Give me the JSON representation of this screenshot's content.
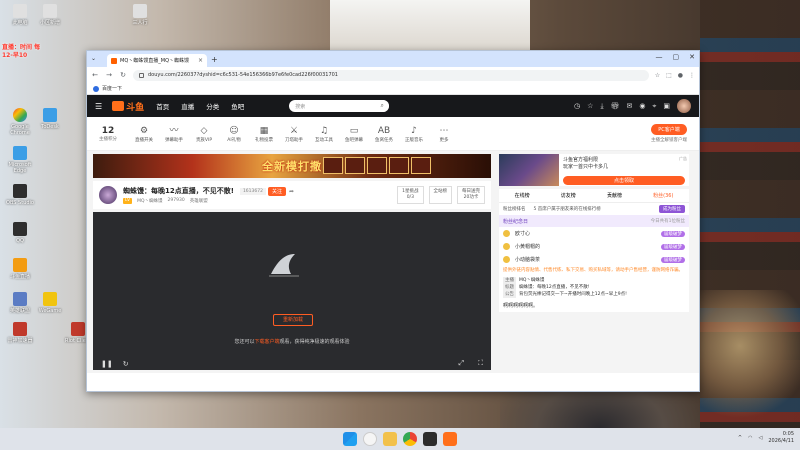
{
  "desktop": {
    "icons": [
      {
        "label": "此电脑",
        "color": "c1"
      },
      {
        "label": "小区新增",
        "color": "c1"
      },
      {
        "label": "三人行",
        "color": "c1"
      },
      {
        "label": "Google Chrome",
        "color": "c2"
      },
      {
        "label": "ToDesk",
        "color": "c3"
      },
      {
        "label": "Microsoft Edge",
        "color": "c3"
      },
      {
        "label": "OBS Studio",
        "color": "c4"
      },
      {
        "label": "QQ",
        "color": "c4"
      },
      {
        "label": "斗鱼直播",
        "color": "c8"
      },
      {
        "label": "英雄联盟",
        "color": "c7"
      },
      {
        "label": "雷神加速器",
        "color": "c5"
      },
      {
        "label": "WeGame",
        "color": "c6"
      },
      {
        "label": "Riot Client",
        "color": "c5"
      }
    ],
    "note": "直播：时间 每12-早10"
  },
  "browser": {
    "tab_title": "MQ丶蜘蛛馒直播_MQ丶蜘蛛馒",
    "url": "douyu.com/226037?dyshid=c6c531-54e156366b97e6fe0cad226f00031701",
    "bookmark": "百度一下"
  },
  "douyu": {
    "logo": "斗鱼",
    "nav": [
      "首页",
      "直播",
      "分类",
      "鱼吧"
    ],
    "search_placeholder": "搜索",
    "func_items": [
      {
        "icon": "⚙",
        "label": "直播开关"
      },
      {
        "icon": "〰",
        "label": "弹幕助手"
      },
      {
        "icon": "◇",
        "label": "贵族VIP"
      },
      {
        "icon": "☺",
        "label": "AI礼物"
      },
      {
        "icon": "▦",
        "label": "礼物投票"
      },
      {
        "icon": "⚔",
        "label": "刀塔助手"
      },
      {
        "icon": "♫",
        "label": "互动工具"
      },
      {
        "icon": "▭",
        "label": "鱼吧弹幕"
      },
      {
        "icon": "AB",
        "label": "鱼窝任务"
      },
      {
        "icon": "♪",
        "label": "正版音乐"
      },
      {
        "icon": "⋯",
        "label": "更多"
      }
    ],
    "level_num": "12",
    "level_label": "主播积分",
    "pc_client": "PC客户端",
    "pc_sub": "主播全解锁客户端",
    "banner_text": "全新模打撒",
    "anchor": {
      "title": "蜘蛛馒：每晚12点直播，不见不散!",
      "id": "1613672",
      "follow": "关注",
      "tag": "LV",
      "name": "MQ丶蜘蛛馒",
      "fans": "297930",
      "category": "英雄联盟",
      "stats": [
        {
          "top": "1星挑战",
          "bottom": "0/3"
        },
        {
          "top": "全站榜",
          "bottom": ""
        },
        {
          "top": "每日送完",
          "bottom": "20功卡"
        }
      ]
    },
    "player": {
      "retry": "重新加载",
      "msg_pre": "您还可以",
      "msg_link": "下载客户端",
      "msg_post": "观看，获得纯净极速的观看体验"
    },
    "promo": {
      "line1": "斗鱼官方福利限",
      "line2": "玩家一首只中卡多几",
      "ad": "广告",
      "btn": "点击领取"
    },
    "right_tabs": [
      "在线榜",
      "访友榜",
      "贡献榜",
      "粉丝(36)"
    ],
    "rank_head": [
      "粉丝榜排名",
      "5 首席户属于朋友来的在线排行榜"
    ],
    "become_fan": "成为粉丝",
    "fanclub": "粉丝纪念日",
    "fanclub_right": "今日共有1位粉丝",
    "rank_items": [
      {
        "name": "欧寸心",
        "lvl": "届级破梦"
      },
      {
        "name": "小黄帽帽的",
        "lvl": "届级破梦"
      },
      {
        "name": "小动脑袋茶",
        "lvl": "届级破梦"
      }
    ],
    "notice": "提供外链内容贴情、代售代练、私下交易、购买私域等，请动手户售经营，谨防网络诈骗。",
    "info": [
      {
        "k": "主播",
        "v": "MQ丶蜘蛛馒"
      },
      {
        "k": "标题",
        "v": "蜘蛛馒：每晚12点直播，不见不散!"
      },
      {
        "k": "公告",
        "v": "背包荧光棒记得交一下~开播时间晚上12点~早上9点!"
      }
    ],
    "chat": "啊啊啊啊啊啊。"
  },
  "taskbar": {
    "time": "0:05",
    "date": "2026/4/11"
  }
}
